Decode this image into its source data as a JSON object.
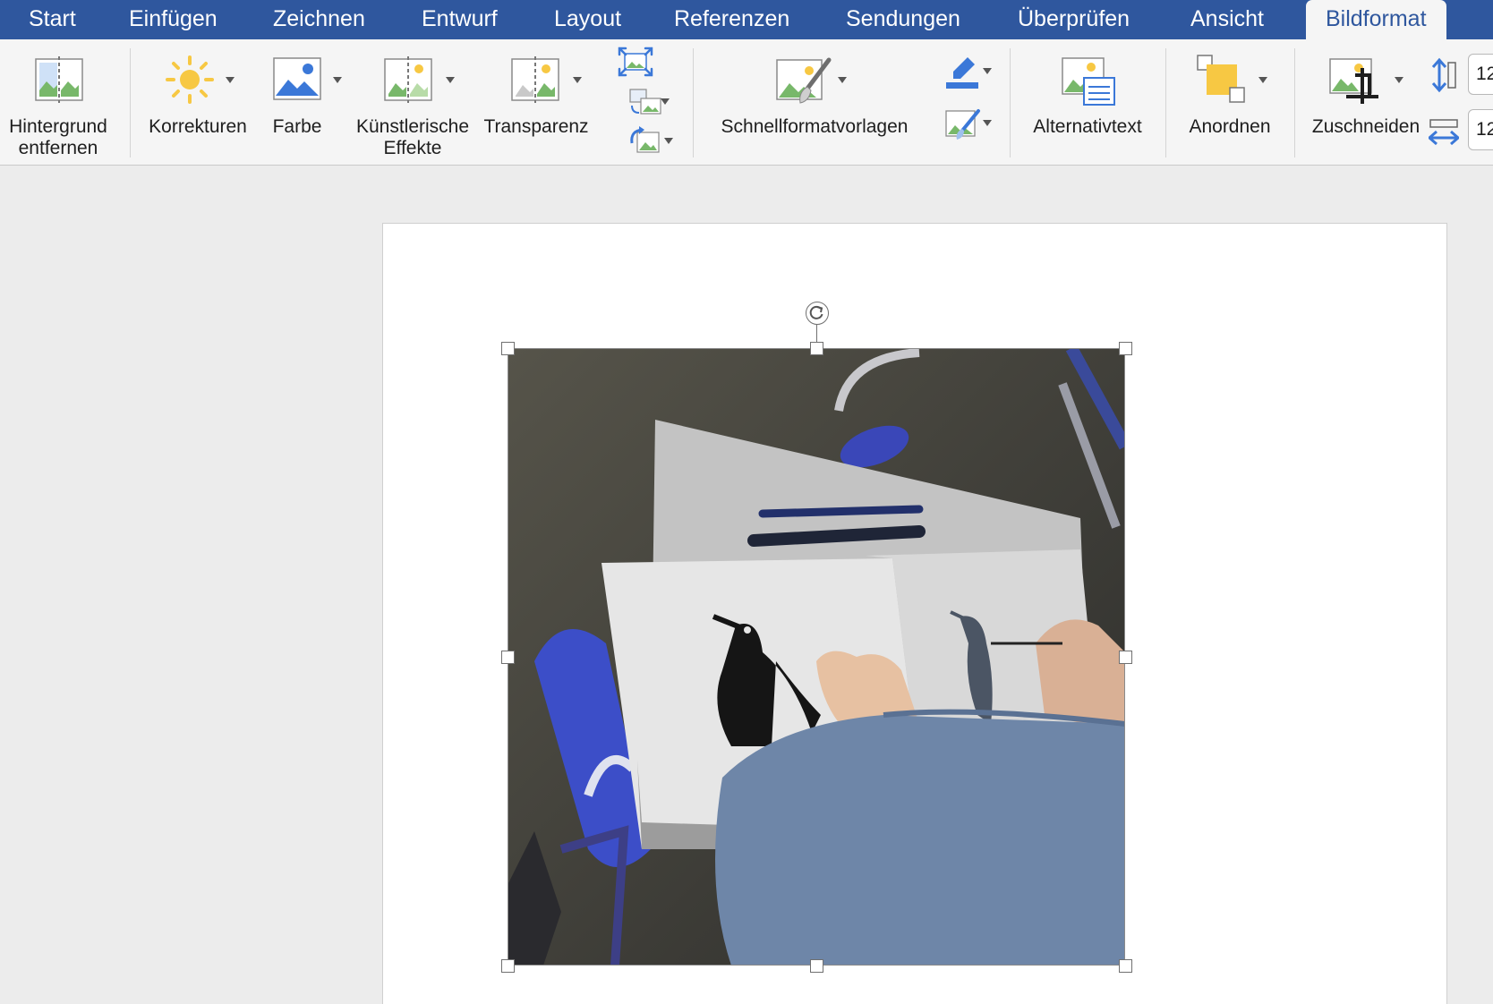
{
  "tabs": [
    {
      "label": "Start"
    },
    {
      "label": "Einfügen"
    },
    {
      "label": "Zeichnen"
    },
    {
      "label": "Entwurf"
    },
    {
      "label": "Layout"
    },
    {
      "label": "Referenzen"
    },
    {
      "label": "Sendungen"
    },
    {
      "label": "Überprüfen"
    },
    {
      "label": "Ansicht"
    },
    {
      "label": "Bildformat",
      "active": true
    }
  ],
  "ribbon": {
    "remove_background": {
      "line1": "Hintergrund",
      "line2": "entfernen",
      "icon": "remove-background-icon"
    },
    "corrections": {
      "label": "Korrekturen",
      "icon": "sun-icon"
    },
    "color": {
      "label": "Farbe",
      "icon": "picture-color-icon"
    },
    "artistic_effects": {
      "line1": "Künstlerische",
      "line2": "Effekte",
      "icon": "artistic-effects-icon"
    },
    "transparency": {
      "label": "Transparenz",
      "icon": "transparency-icon"
    },
    "compress": {
      "icon": "compress-pictures-icon"
    },
    "change_picture": {
      "icon": "change-picture-icon"
    },
    "reset_picture": {
      "icon": "reset-picture-icon"
    },
    "quick_styles": {
      "label": "Schnellformatvorlagen",
      "icon": "quick-styles-icon"
    },
    "picture_border": {
      "icon": "picture-border-icon"
    },
    "picture_effects": {
      "icon": "picture-effects-icon"
    },
    "alt_text": {
      "label": "Alternativtext",
      "icon": "alt-text-icon"
    },
    "arrange": {
      "label": "Anordnen",
      "icon": "arrange-icon"
    },
    "crop": {
      "label": "Zuschneiden",
      "icon": "crop-icon"
    },
    "height": {
      "value": "12",
      "icon": "height-icon"
    },
    "width": {
      "value": "12",
      "icon": "width-icon"
    }
  },
  "colors": {
    "tab_bar": "#2f579e",
    "ribbon_bg": "#f5f5f5",
    "canvas_bg": "#ececec",
    "accent_blue": "#3b78d8",
    "accent_yellow": "#f7c843"
  }
}
